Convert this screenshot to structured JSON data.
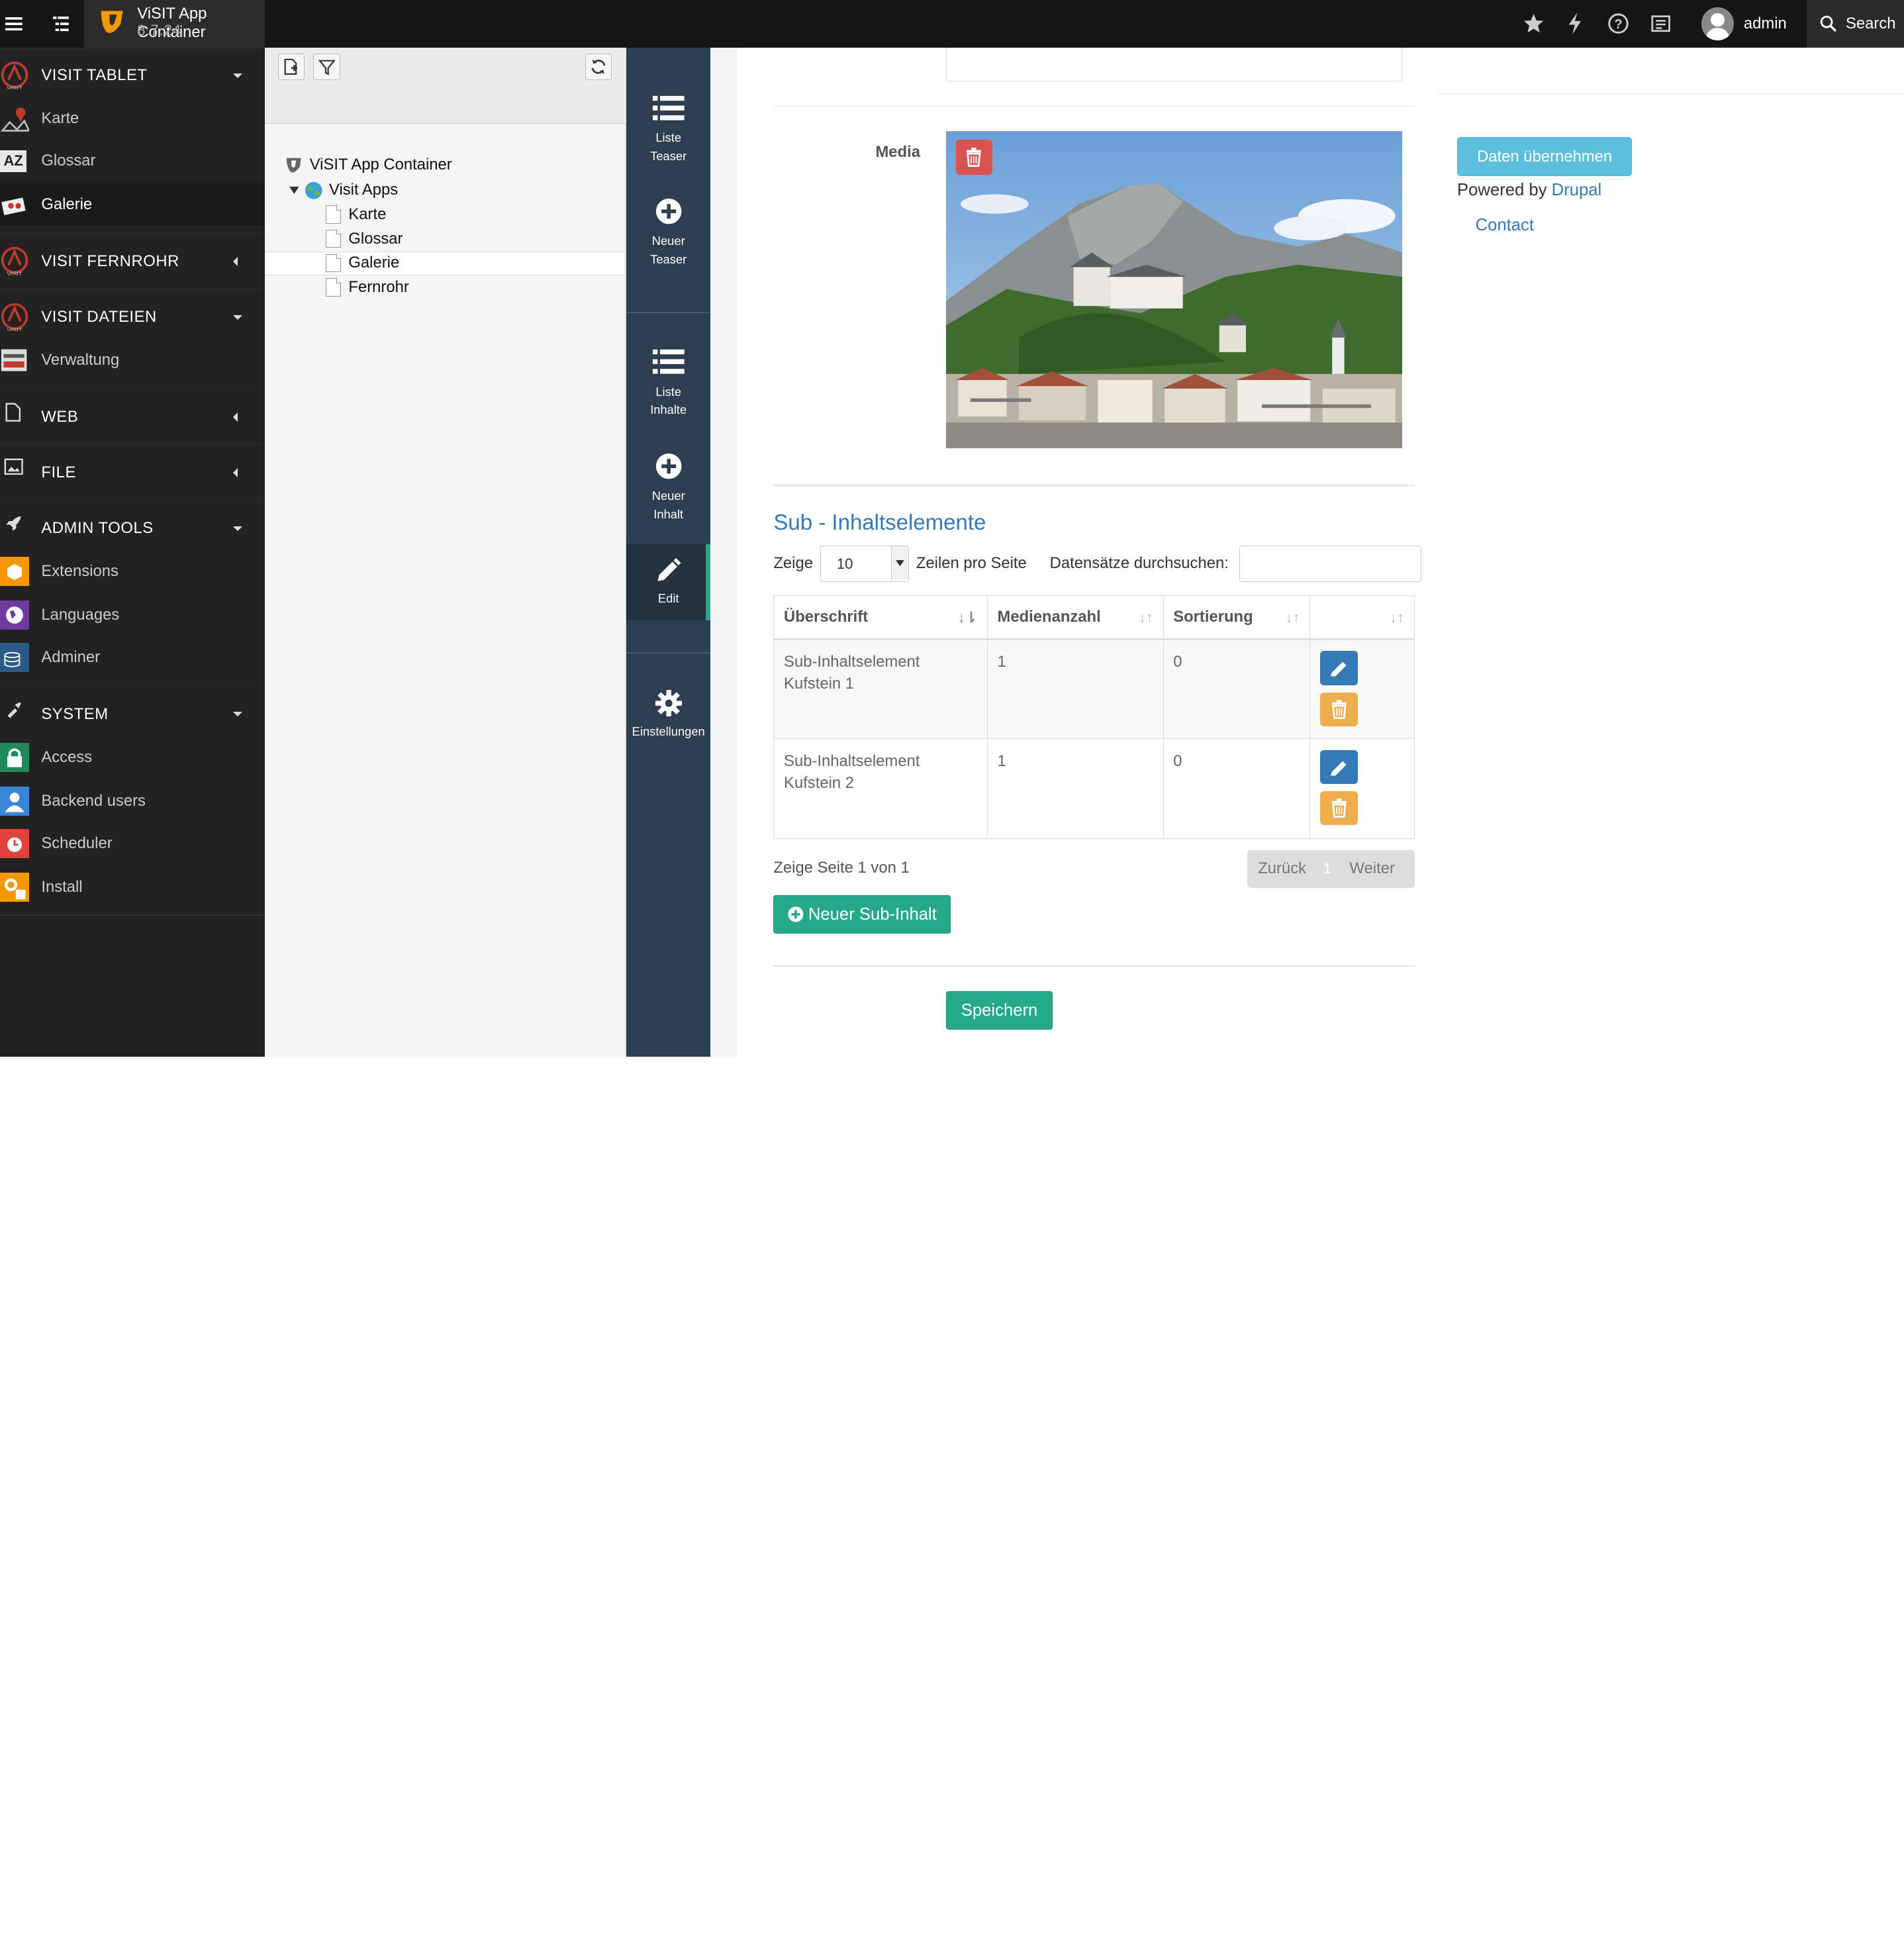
{
  "topbar": {
    "app_title": "ViSIT App Container",
    "app_version": "8.7.24",
    "user": "admin",
    "search_label": "Search"
  },
  "sidebar": {
    "sections": [
      {
        "label": "VISIT TABLET",
        "items": [
          "Karte",
          "Glossar",
          "Galerie"
        ]
      },
      {
        "label": "VISIT FERNROHR",
        "items": []
      },
      {
        "label": "VISIT DATEIEN",
        "items": [
          "Verwaltung"
        ]
      },
      {
        "label": "WEB",
        "items": []
      },
      {
        "label": "FILE",
        "items": []
      },
      {
        "label": "ADMIN TOOLS",
        "items": [
          "Extensions",
          "Languages",
          "Adminer"
        ]
      },
      {
        "label": "SYSTEM",
        "items": [
          "Access",
          "Backend users",
          "Scheduler",
          "Install"
        ]
      }
    ]
  },
  "tree": {
    "root": "ViSIT App Container",
    "folder": "Visit Apps",
    "pages": [
      "Karte",
      "Glossar",
      "Galerie",
      "Fernrohr"
    ]
  },
  "module_menu": {
    "liste_teaser": [
      "Liste",
      "Teaser"
    ],
    "neuer_teaser": [
      "Neuer",
      "Teaser"
    ],
    "liste_inhalte": [
      "Liste",
      "Inhalte"
    ],
    "neuer_inhalt": [
      "Neuer",
      "Inhalt"
    ],
    "edit": "Edit",
    "einstellungen": "Einstellungen"
  },
  "form": {
    "media_label": "Media",
    "sub_title": "Sub - Inhaltselemente",
    "show_prefix": "Zeige",
    "per_page_value": "10",
    "show_suffix": "Zeilen pro Seite",
    "search_label": "Datensätze durchsuchen:",
    "table": {
      "headers": [
        "Überschrift",
        "Medienanzahl",
        "Sortierung",
        ""
      ],
      "rows": [
        {
          "title_line1": "Sub-Inhaltselement",
          "title_line2": "Kufstein 1",
          "media": "1",
          "sort": "0"
        },
        {
          "title_line1": "Sub-Inhaltselement",
          "title_line2": "Kufstein 2",
          "media": "1",
          "sort": "0"
        }
      ]
    },
    "page_info": "Zeige Seite 1 von 1",
    "pager": {
      "prev": "Zurück",
      "current": "1",
      "next": "Weiter"
    },
    "new_sub_button": "Neuer Sub-Inhalt",
    "save_button": "Speichern"
  },
  "right_panel": {
    "daten_button": "Daten übernehmen",
    "powered_by": "Powered by",
    "drupal": "Drupal",
    "contact": "Contact"
  },
  "colors": {
    "accent_green": "#26a98b",
    "info_blue": "#5bc0de",
    "link_blue": "#337ab7",
    "danger_red": "#d9534f",
    "warning_orange": "#f0ad4e",
    "module_bg": "#2d3e50"
  }
}
